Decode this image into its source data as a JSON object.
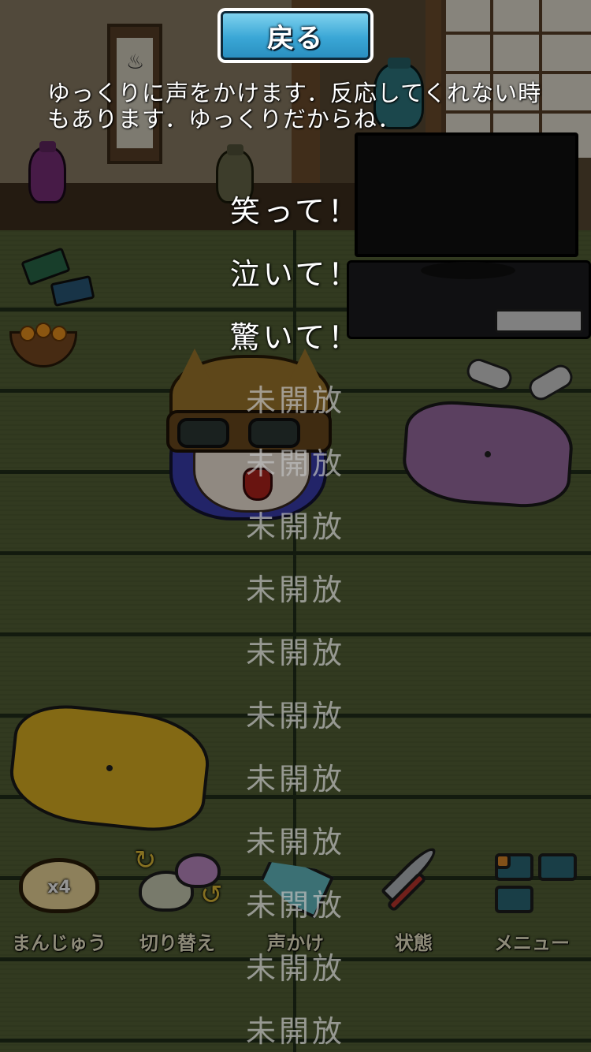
{
  "header": {
    "back_label": "戻る"
  },
  "instructions": "ゆっくりに声をかけます．反応してくれない時もあります．ゆっくりだからね．",
  "voice_options": [
    {
      "label": "笑って！",
      "unlocked": true
    },
    {
      "label": "泣いて！",
      "unlocked": true
    },
    {
      "label": "驚いて！",
      "unlocked": true
    },
    {
      "label": "未開放",
      "unlocked": false
    },
    {
      "label": "未開放",
      "unlocked": false
    },
    {
      "label": "未開放",
      "unlocked": false
    },
    {
      "label": "未開放",
      "unlocked": false
    },
    {
      "label": "未開放",
      "unlocked": false
    },
    {
      "label": "未開放",
      "unlocked": false
    },
    {
      "label": "未開放",
      "unlocked": false
    },
    {
      "label": "未開放",
      "unlocked": false
    },
    {
      "label": "未開放",
      "unlocked": false
    },
    {
      "label": "未開放",
      "unlocked": false
    },
    {
      "label": "未開放",
      "unlocked": false
    }
  ],
  "toolbar": {
    "manju_label": "まんじゅう",
    "manju_count": "x4",
    "switch_label": "切り替え",
    "voice_label": "声かけ",
    "status_label": "状態",
    "menu_label": "メニュー"
  },
  "colors": {
    "back_button": "#3aa7d6",
    "unlocked_text": "#ffffff",
    "locked_text": "#bebebe"
  }
}
